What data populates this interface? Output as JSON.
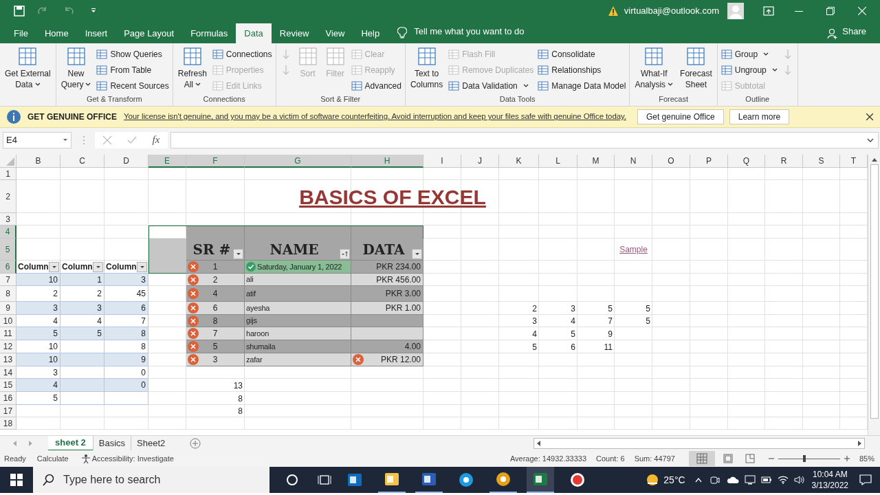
{
  "account": {
    "email": "virtualbaji@outlook.com"
  },
  "tabs": [
    {
      "label": "File",
      "selected": false
    },
    {
      "label": "Home",
      "selected": false
    },
    {
      "label": "Insert",
      "selected": false
    },
    {
      "label": "Page Layout",
      "selected": false
    },
    {
      "label": "Formulas",
      "selected": false
    },
    {
      "label": "Data",
      "selected": true
    },
    {
      "label": "Review",
      "selected": false
    },
    {
      "label": "View",
      "selected": false
    },
    {
      "label": "Help",
      "selected": false
    }
  ],
  "tell_me": {
    "placeholder": "Tell me what you want to do"
  },
  "share": {
    "label": "Share"
  },
  "ribbon_groups": [
    {
      "stacks": [
        [
          {
            "kind": "large",
            "lines": [
              "Get External",
              "Data"
            ],
            "dropdown": true,
            "disabled": false
          }
        ]
      ]
    },
    {
      "label": "Get & Transform",
      "stacks": [
        [
          {
            "kind": "large",
            "lines": [
              "New",
              "Query"
            ],
            "dropdown": true,
            "disabled": false
          }
        ],
        [
          {
            "kind": "small",
            "label": "Show Queries",
            "disabled": false
          },
          {
            "kind": "small",
            "label": "From Table",
            "disabled": false
          },
          {
            "kind": "small",
            "label": "Recent Sources",
            "disabled": false
          }
        ]
      ]
    },
    {
      "label": "Connections",
      "stacks": [
        [
          {
            "kind": "large",
            "lines": [
              "Refresh",
              "All"
            ],
            "dropdown": true,
            "disabled": false
          }
        ],
        [
          {
            "kind": "small",
            "label": "Connections",
            "disabled": false
          },
          {
            "kind": "small",
            "label": "Properties",
            "disabled": true
          },
          {
            "kind": "small",
            "label": "Edit Links",
            "disabled": true
          }
        ]
      ]
    },
    {
      "label": "Sort & Filter",
      "stacks": [
        [
          {
            "kind": "icon",
            "disabled": true
          },
          {
            "kind": "icon",
            "disabled": true
          }
        ],
        [
          {
            "kind": "large",
            "lines": [
              "Sort"
            ],
            "disabled": true
          }
        ],
        [
          {
            "kind": "large",
            "lines": [
              "Filter"
            ],
            "disabled": true
          }
        ],
        [
          {
            "kind": "small",
            "label": "Clear",
            "disabled": true
          },
          {
            "kind": "small",
            "label": "Reapply",
            "disabled": true
          },
          {
            "kind": "small",
            "label": "Advanced",
            "disabled": false
          }
        ]
      ]
    },
    {
      "label": "Data Tools",
      "stacks": [
        [
          {
            "kind": "large",
            "lines": [
              "Text to",
              "Columns"
            ],
            "disabled": false
          }
        ],
        [
          {
            "kind": "small",
            "label": "Flash Fill",
            "disabled": true
          },
          {
            "kind": "small",
            "label": "Remove Duplicates",
            "disabled": true
          },
          {
            "kind": "small",
            "label": "Data Validation",
            "dropdown": true,
            "disabled": false
          }
        ],
        [
          {
            "kind": "small",
            "label": "Consolidate",
            "disabled": false
          },
          {
            "kind": "small",
            "label": "Relationships",
            "disabled": false
          },
          {
            "kind": "small",
            "label": "Manage Data Model",
            "disabled": false
          }
        ]
      ]
    },
    {
      "label": "Forecast",
      "stacks": [
        [
          {
            "kind": "large",
            "lines": [
              "What-If",
              "Analysis"
            ],
            "dropdown": true,
            "disabled": false
          }
        ],
        [
          {
            "kind": "large",
            "lines": [
              "Forecast",
              "Sheet"
            ],
            "disabled": false
          }
        ]
      ]
    },
    {
      "label": "Outline",
      "stacks": [
        [
          {
            "kind": "small",
            "label": "Group",
            "dropdown": true,
            "disabled": false
          },
          {
            "kind": "small",
            "label": "Ungroup",
            "dropdown": true,
            "disabled": false
          },
          {
            "kind": "small",
            "label": "Subtotal",
            "disabled": true
          }
        ],
        [
          {
            "kind": "icon",
            "disabled": true
          },
          {
            "kind": "icon",
            "disabled": true
          }
        ]
      ]
    }
  ],
  "banner": {
    "title": "GET GENUINE OFFICE",
    "message": "Your license isn't genuine, and you may be a victim of software counterfeiting. Avoid interruption and keep your files safe with genuine Office today.",
    "buttons": [
      "Get genuine Office",
      "Learn more"
    ]
  },
  "formula_bar": {
    "name_box": "E4",
    "fx": "fx"
  },
  "columns": [
    {
      "label": "B",
      "selected": false
    },
    {
      "label": "C",
      "selected": false
    },
    {
      "label": "D",
      "selected": false
    },
    {
      "label": "E",
      "selected": true
    },
    {
      "label": "F",
      "selected": true
    },
    {
      "label": "G",
      "selected": true
    },
    {
      "label": "H",
      "selected": true
    },
    {
      "label": "I",
      "selected": false
    },
    {
      "label": "J",
      "selected": false
    },
    {
      "label": "K",
      "selected": false
    },
    {
      "label": "L",
      "selected": false
    },
    {
      "label": "M",
      "selected": false
    },
    {
      "label": "N",
      "selected": false
    },
    {
      "label": "O",
      "selected": false
    },
    {
      "label": "P",
      "selected": false
    },
    {
      "label": "Q",
      "selected": false
    },
    {
      "label": "R",
      "selected": false
    },
    {
      "label": "S",
      "selected": false
    },
    {
      "label": "T",
      "selected": false
    }
  ],
  "rows": [
    {
      "label": "1",
      "selected": false
    },
    {
      "label": "2",
      "selected": false
    },
    {
      "label": "3",
      "selected": false
    },
    {
      "label": "4",
      "selected": true
    },
    {
      "label": "5",
      "selected": true
    },
    {
      "label": "6",
      "selected": true
    },
    {
      "label": "7",
      "selected": false
    },
    {
      "label": "8",
      "selected": false
    },
    {
      "label": "9",
      "selected": false
    },
    {
      "label": "10",
      "selected": false
    },
    {
      "label": "11",
      "selected": false
    },
    {
      "label": "12",
      "selected": false
    },
    {
      "label": "13",
      "selected": false
    },
    {
      "label": "14",
      "selected": false
    },
    {
      "label": "15",
      "selected": false
    },
    {
      "label": "16",
      "selected": false
    },
    {
      "label": "17",
      "selected": false
    },
    {
      "label": "18",
      "selected": false
    }
  ],
  "sheet_title": "BASICS OF EXCEL",
  "link": "Sample",
  "left_table": {
    "headers": [
      {
        "label": "Column"
      },
      {
        "label": "Column"
      },
      {
        "label": "Column"
      }
    ],
    "rows": [
      {
        "cells": [
          {
            "text": "10"
          },
          {
            "text": "1"
          },
          {
            "text": "3"
          }
        ]
      },
      {
        "cells": [
          {
            "text": "2"
          },
          {
            "text": "2"
          },
          {
            "text": "45"
          }
        ]
      },
      {
        "cells": [
          {
            "text": "3"
          },
          {
            "text": "3"
          },
          {
            "text": "6"
          }
        ]
      },
      {
        "cells": [
          {
            "text": "4"
          },
          {
            "text": "4"
          },
          {
            "text": "7"
          }
        ]
      },
      {
        "cells": [
          {
            "text": "5"
          },
          {
            "text": "5"
          },
          {
            "text": "8"
          }
        ]
      },
      {
        "cells": [
          {
            "text": "10"
          },
          {},
          {
            "text": "8"
          }
        ]
      },
      {
        "cells": [
          {
            "text": "10"
          },
          {},
          {
            "text": "9"
          }
        ]
      },
      {
        "cells": [
          {
            "text": "3"
          },
          {},
          {
            "text": "0"
          }
        ]
      },
      {
        "cells": [
          {
            "text": "4"
          },
          {},
          {
            "text": "0"
          }
        ]
      },
      {
        "cells": [
          {
            "text": "5"
          },
          {},
          {}
        ]
      }
    ]
  },
  "data_table": {
    "headers": [
      {
        "label": "SR #",
        "sorted": false
      },
      {
        "label": "NAME",
        "sorted": true
      },
      {
        "label": "DATA",
        "sorted": false
      }
    ],
    "rows": [
      {
        "sr": {
          "text": "1",
          "error": true
        },
        "name": {
          "text": "Saturday, January 1, 2022",
          "valid": true
        },
        "data": {
          "text": "PKR 234.00",
          "error": false
        }
      },
      {
        "sr": {
          "text": "2",
          "error": true
        },
        "name": {
          "text": "ali",
          "valid": false
        },
        "data": {
          "text": "PKR 456.00",
          "error": false
        }
      },
      {
        "sr": {
          "text": "4",
          "error": true
        },
        "name": {
          "text": "atif",
          "valid": false
        },
        "data": {
          "text": "PKR 3.00",
          "error": false
        }
      },
      {
        "sr": {
          "text": "6",
          "error": true
        },
        "name": {
          "text": "ayesha",
          "valid": false
        },
        "data": {
          "text": "PKR 1.00",
          "error": false
        }
      },
      {
        "sr": {
          "text": "8",
          "error": true
        },
        "name": {
          "text": "gijs",
          "valid": false
        },
        "data": {
          "error": false
        }
      },
      {
        "sr": {
          "text": "7",
          "error": true
        },
        "name": {
          "text": "haroon",
          "valid": false
        },
        "data": {
          "error": false
        }
      },
      {
        "sr": {
          "text": "5",
          "error": true
        },
        "name": {
          "text": "shumaila",
          "valid": false
        },
        "data": {
          "text": "4.00",
          "error": false
        }
      },
      {
        "sr": {
          "text": "3",
          "error": true
        },
        "name": {
          "text": "zafar",
          "valid": false
        },
        "data": {
          "text": "PKR 12.00",
          "error": true
        }
      }
    ]
  },
  "loose_values": [
    "13",
    "8",
    "8"
  ],
  "number_block": [
    {
      "cells": [
        "2",
        "3",
        "5",
        "5"
      ]
    },
    {
      "cells": [
        "3",
        "4",
        "7",
        "5"
      ]
    },
    {
      "cells": [
        "4",
        "5",
        "9"
      ]
    },
    {
      "cells": [
        "5",
        "6",
        "11"
      ]
    }
  ],
  "sheet_tabs": [
    {
      "label": "sheet 2",
      "selected": true
    },
    {
      "label": "Basics",
      "selected": false
    },
    {
      "label": "Sheet2",
      "selected": false
    }
  ],
  "status_bar": {
    "left": [
      "Ready",
      "Calculate"
    ],
    "accessibility": "Accessibility: Investigate",
    "stats": [
      "Average: 14932.33333",
      "Count: 6",
      "Sum: 44797"
    ],
    "zoom": {
      "level": 0.42,
      "reading": "85%"
    }
  },
  "taskbar": {
    "search": {
      "placeholder": "Type here to search"
    },
    "temperature": "25°C",
    "time": "10:04 AM",
    "date": "3/13/2022"
  }
}
